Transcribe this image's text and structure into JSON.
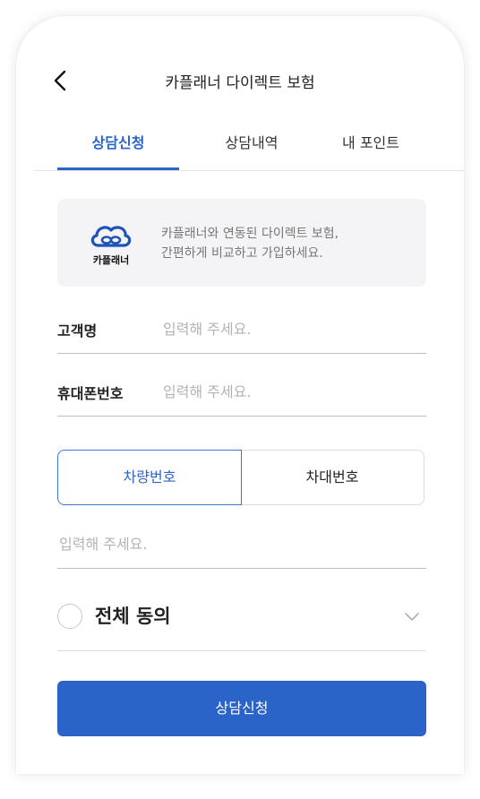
{
  "header": {
    "title": "카플래너 다이렉트 보험",
    "back_icon": "chevron-left-icon"
  },
  "tabs": [
    {
      "label": "상담신청",
      "active": true
    },
    {
      "label": "상담내역",
      "active": false
    },
    {
      "label": "내 포인트",
      "active": false
    }
  ],
  "info": {
    "logo_text": "카플래너",
    "logo_icon": "cloud-link-icon",
    "line1": "카플래너와 연동된 다이렉트 보험,",
    "line2": "간편하게 비교하고 가입하세요."
  },
  "form": {
    "name_label": "고객명",
    "name_placeholder": "입력해 주세요.",
    "phone_label": "휴대폰번호",
    "phone_placeholder": "입력해 주세요.",
    "segment": {
      "left": "차량번호",
      "right": "차대번호",
      "selected": "차량번호"
    },
    "vehicle_placeholder": "입력해 주세요."
  },
  "agree": {
    "label": "전체 동의",
    "checked": false,
    "chevron_icon": "chevron-down-icon"
  },
  "submit_label": "상담신청",
  "colors": {
    "accent": "#2a64c8",
    "info_bg": "#f4f4f6",
    "placeholder": "#b3b3b3"
  }
}
